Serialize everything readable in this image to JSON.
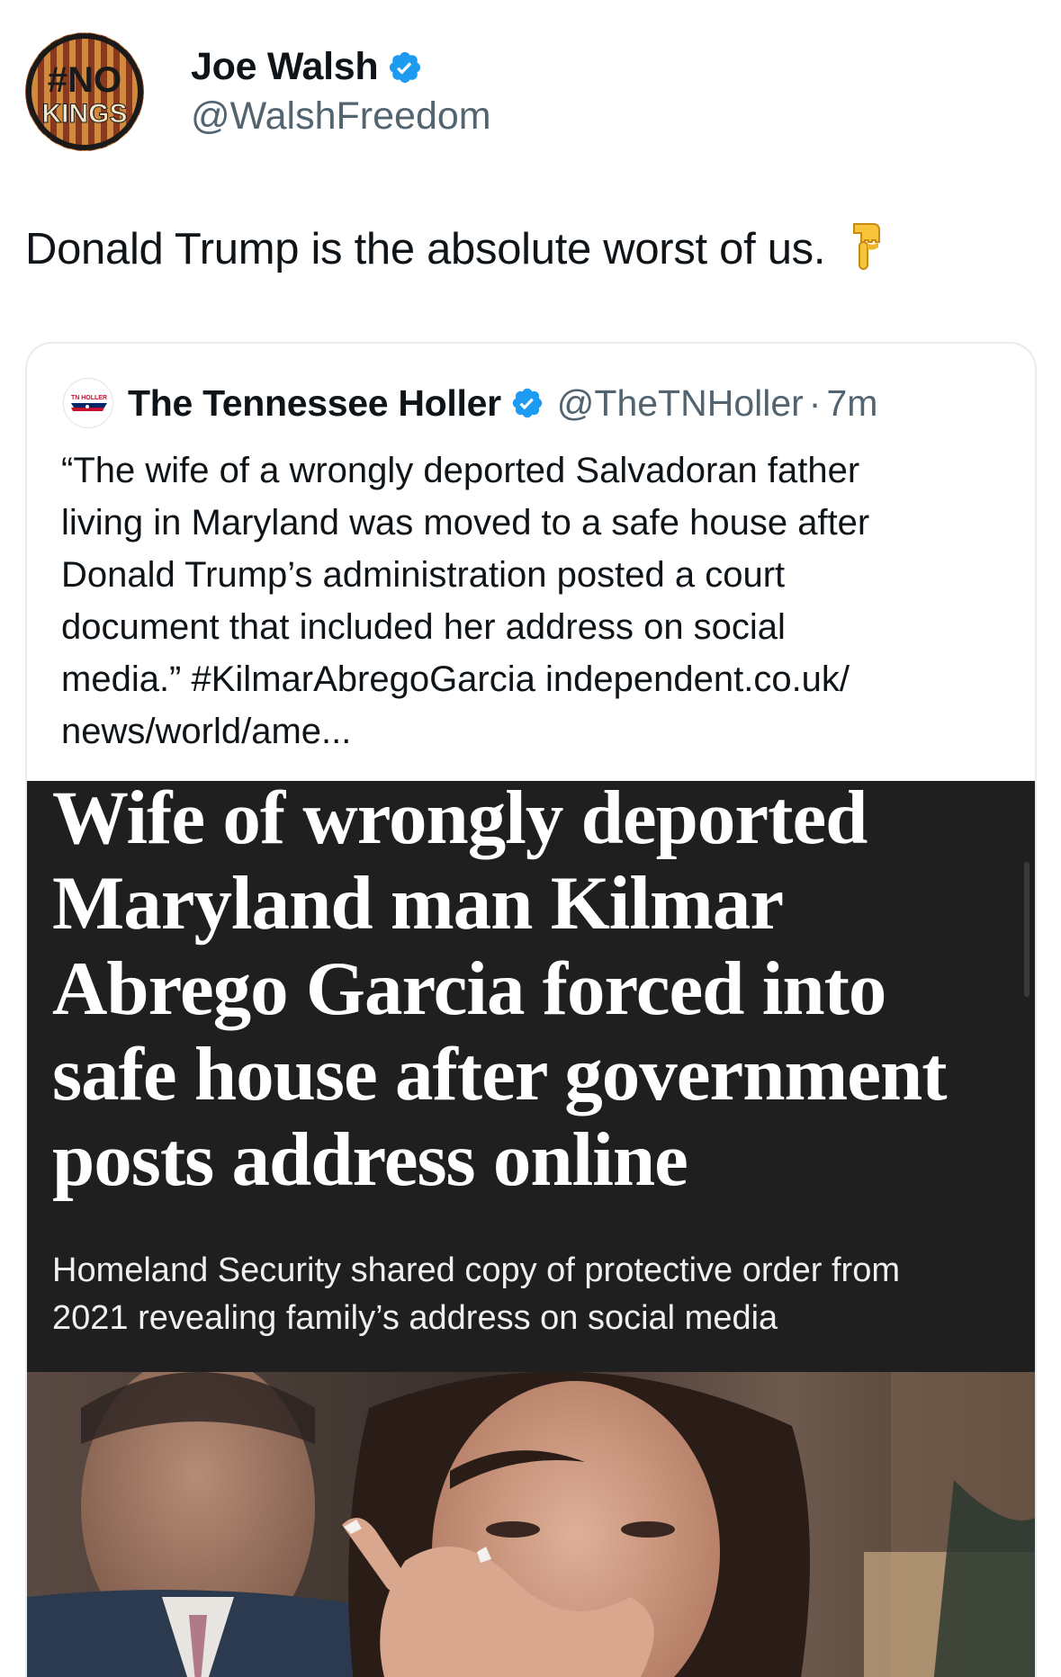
{
  "tweet": {
    "author": {
      "name": "Joe Walsh",
      "handle": "@WalshFreedom",
      "avatar_text_top": "#NO",
      "avatar_text_bottom": "KINGS",
      "verified": true
    },
    "text": "Donald Trump is the absolute worst of us.",
    "emoji": "backhand-index-pointing-down"
  },
  "quoted": {
    "author": {
      "name": "The Tennessee Holler",
      "handle": "@TheTNHoller",
      "time": "7m",
      "avatar_text": "TN HOLLER",
      "verified": true
    },
    "text_lines": [
      "“The wife of a wrongly deported Salvadoran father",
      "living in Maryland was moved to a safe house after",
      "Donald Trump’s administration posted a court",
      "document that included her address on social",
      "media.” #KilmarAbregoGarcia independent.co.uk/",
      "news/world/ame..."
    ],
    "image": {
      "headline_lines": [
        "Wife of wrongly deported",
        "Maryland man Kilmar",
        "Abrego Garcia forced into",
        "safe house after government",
        "posts address online"
      ],
      "subhead_lines": [
        "Homeland Security shared copy of protective order from",
        "2021 revealing family’s address on social media"
      ]
    }
  },
  "colors": {
    "text": "#0f1419",
    "secondary": "#536471",
    "verified_blue": "#1d9bf0",
    "card_border": "#e6ecf0",
    "headline_bg": "#1f1f1f"
  }
}
